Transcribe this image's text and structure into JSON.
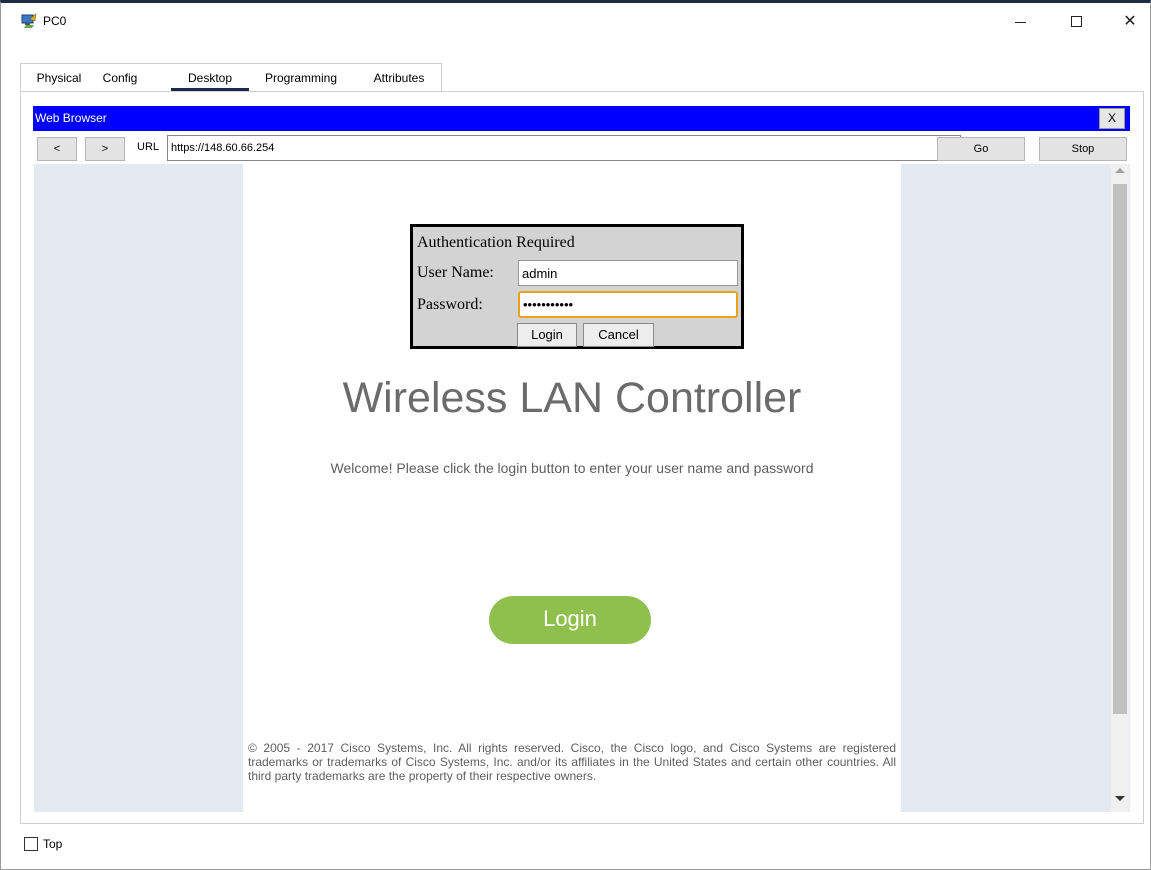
{
  "window": {
    "title": "PC0",
    "minimize": "",
    "maximize": "",
    "close": "✕"
  },
  "tabs": [
    {
      "label": "Physical"
    },
    {
      "label": "Config"
    },
    {
      "label": "Desktop",
      "active": true
    },
    {
      "label": "Programming"
    },
    {
      "label": "Attributes"
    }
  ],
  "browser": {
    "title": "Web Browser",
    "close_label": "X",
    "back_label": "<",
    "forward_label": ">",
    "url_label": "URL",
    "url_value": "https://148.60.66.254",
    "go_label": "Go",
    "stop_label": "Stop"
  },
  "auth_dialog": {
    "title": "Authentication Required",
    "username_label": "User Name:",
    "username_value": "admin",
    "password_label": "Password:",
    "password_value": "•••••••••••",
    "login_label": "Login",
    "cancel_label": "Cancel"
  },
  "page": {
    "title": "Wireless LAN Controller",
    "welcome": "Welcome! Please click the login button to enter your user name and password",
    "login_button": "Login",
    "copyright": "© 2005 - 2017 Cisco Systems, Inc. All rights reserved. Cisco, the Cisco logo, and Cisco Systems are registered trademarks or trademarks of Cisco Systems, Inc. and/or its affiliates in the United States and certain other countries. All third party trademarks are the property of their respective owners."
  },
  "footer": {
    "top_label": "Top",
    "top_checked": false
  },
  "colors": {
    "browser_header": "#0000ff",
    "login_button": "#8fbf4d",
    "password_focus": "#e8a31c",
    "viewport_bg": "#e5e9f2"
  }
}
